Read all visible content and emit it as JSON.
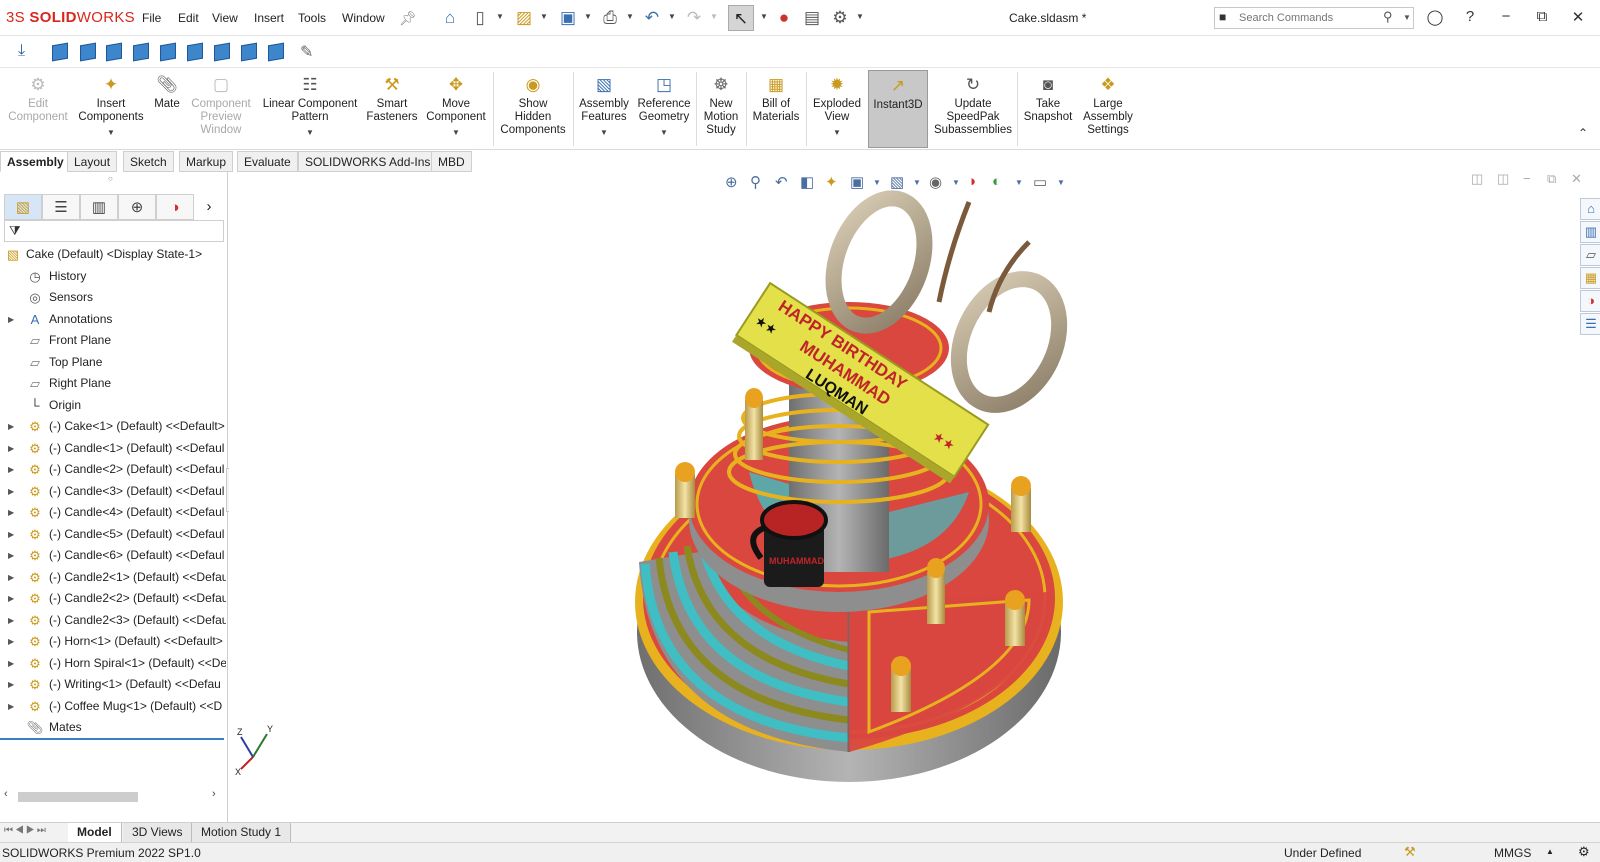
{
  "titlebar": {
    "brand_prefix": "3S",
    "brand_bold": "SOLID",
    "brand_rest": "WORKS",
    "menu": [
      "File",
      "Edit",
      "View",
      "Insert",
      "Tools",
      "Window"
    ],
    "doc_title": "Cake.sldasm *",
    "search_placeholder": "Search Commands",
    "icons": [
      "pin-icon",
      "home-icon",
      "new-document-icon",
      "open-icon",
      "save-icon",
      "print-icon",
      "undo-icon",
      "redo-icon",
      "select-icon",
      "traffic-light-icon",
      "file-properties-icon",
      "options-icon"
    ]
  },
  "ribbon": {
    "commands": [
      {
        "label_lines": [
          "Edit",
          "Component"
        ],
        "disabled": true,
        "caret": false
      },
      {
        "label_lines": [
          "Insert",
          "Components"
        ],
        "disabled": false,
        "caret": true
      },
      {
        "label_lines": [
          "Mate"
        ],
        "disabled": false,
        "caret": false
      },
      {
        "label_lines": [
          "Component",
          "Preview",
          "Window"
        ],
        "disabled": true,
        "caret": false
      },
      {
        "label_lines": [
          "Linear Component",
          "Pattern"
        ],
        "disabled": false,
        "caret": true
      },
      {
        "label_lines": [
          "Smart",
          "Fasteners"
        ],
        "disabled": false,
        "caret": false
      },
      {
        "label_lines": [
          "Move",
          "Component"
        ],
        "disabled": false,
        "caret": true
      },
      {
        "label_lines": [
          "Show",
          "Hidden",
          "Components"
        ],
        "disabled": false,
        "caret": false
      },
      {
        "label_lines": [
          "Assembly",
          "Features"
        ],
        "disabled": false,
        "caret": true
      },
      {
        "label_lines": [
          "Reference",
          "Geometry"
        ],
        "disabled": false,
        "caret": true
      },
      {
        "label_lines": [
          "New",
          "Motion",
          "Study"
        ],
        "disabled": false,
        "caret": false
      },
      {
        "label_lines": [
          "Bill of",
          "Materials"
        ],
        "disabled": false,
        "caret": false
      },
      {
        "label_lines": [
          "Exploded",
          "View"
        ],
        "disabled": false,
        "caret": true
      },
      {
        "label_lines": [
          "Instant3D"
        ],
        "disabled": false,
        "caret": false,
        "active": true
      },
      {
        "label_lines": [
          "Update",
          "SpeedPak",
          "Subassemblies"
        ],
        "disabled": false,
        "caret": false
      },
      {
        "label_lines": [
          "Take",
          "Snapshot"
        ],
        "disabled": false,
        "caret": false
      },
      {
        "label_lines": [
          "Large",
          "Assembly",
          "Settings"
        ],
        "disabled": false,
        "caret": false
      }
    ],
    "tabs": [
      "Assembly",
      "Layout",
      "Sketch",
      "Markup",
      "Evaluate",
      "SOLIDWORKS Add-Ins",
      "MBD"
    ],
    "active_tab": "Assembly"
  },
  "tree": {
    "root": "Cake (Default) <Display State-1>",
    "items": [
      {
        "label": "History",
        "icon": "history-icon",
        "expandable": false
      },
      {
        "label": "Sensors",
        "icon": "sensors-icon",
        "expandable": false
      },
      {
        "label": "Annotations",
        "icon": "annotations-icon",
        "expandable": true
      },
      {
        "label": "Front Plane",
        "icon": "plane-icon",
        "expandable": false
      },
      {
        "label": "Top Plane",
        "icon": "plane-icon",
        "expandable": false
      },
      {
        "label": "Right Plane",
        "icon": "plane-icon",
        "expandable": false
      },
      {
        "label": "Origin",
        "icon": "origin-icon",
        "expandable": false
      },
      {
        "label": "(-) Cake<1> (Default) <<Default>",
        "icon": "part-icon",
        "expandable": true
      },
      {
        "label": "(-) Candle<1> (Default) <<Defaul",
        "icon": "part-icon",
        "expandable": true
      },
      {
        "label": "(-) Candle<2> (Default) <<Defaul",
        "icon": "part-icon",
        "expandable": true
      },
      {
        "label": "(-) Candle<3> (Default) <<Defaul",
        "icon": "part-icon",
        "expandable": true
      },
      {
        "label": "(-) Candle<4> (Default) <<Defaul",
        "icon": "part-icon",
        "expandable": true
      },
      {
        "label": "(-) Candle<5> (Default) <<Defaul",
        "icon": "part-icon",
        "expandable": true
      },
      {
        "label": "(-) Candle<6> (Default) <<Defaul",
        "icon": "part-icon",
        "expandable": true
      },
      {
        "label": "(-) Candle2<1> (Default) <<Defau",
        "icon": "part-icon",
        "expandable": true
      },
      {
        "label": "(-) Candle2<2> (Default) <<Defau",
        "icon": "part-icon",
        "expandable": true
      },
      {
        "label": "(-) Candle2<3> (Default) <<Defau",
        "icon": "part-icon",
        "expandable": true
      },
      {
        "label": "(-) Horn<1> (Default) <<Default>",
        "icon": "part-icon",
        "expandable": true
      },
      {
        "label": "(-) Horn Spiral<1> (Default) <<De",
        "icon": "part-icon",
        "expandable": true
      },
      {
        "label": "(-) Writing<1> (Default) <<Defau",
        "icon": "part-icon",
        "expandable": true
      },
      {
        "label": "(-) Coffee Mug<1> (Default) <<D",
        "icon": "part-icon",
        "expandable": true
      },
      {
        "label": "Mates",
        "icon": "mates-icon",
        "expandable": false
      }
    ]
  },
  "model": {
    "banner_line1": "HAPPY BIRTHDAY",
    "banner_line2": "MUHAMMAD",
    "banner_line3": "LUQMAN",
    "mug_text": "MUHAMMAD",
    "colors": {
      "cake_red": "#d9473f",
      "gold": "#e8b21f",
      "teal": "#3fbfc4",
      "olive": "#8c8a1e",
      "grey": "#8e8e8e",
      "banner": "#e3e04a"
    }
  },
  "triad": {
    "x": "X",
    "y": "Y",
    "z": "Z"
  },
  "bottom_tabs": [
    "Model",
    "3D Views",
    "Motion Study 1"
  ],
  "active_bottom_tab": "Model",
  "status": {
    "product": "SOLIDWORKS Premium 2022 SP1.0",
    "state": "Under Defined",
    "units": "MMGS"
  }
}
